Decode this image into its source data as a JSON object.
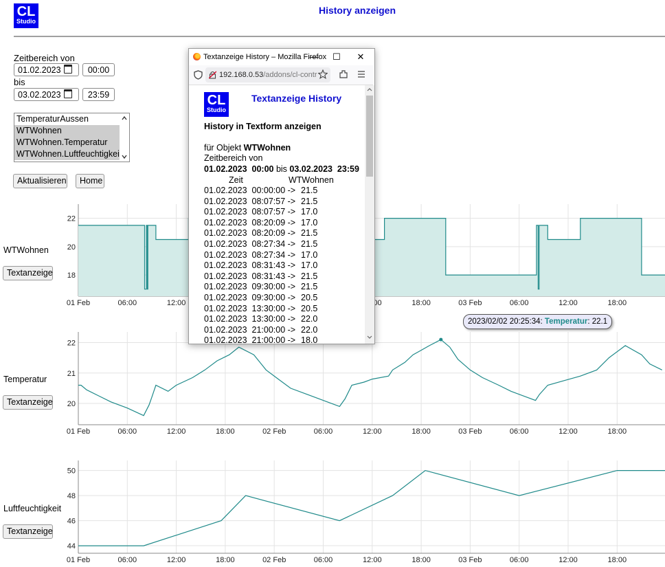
{
  "header": {
    "logo_line1": "CL",
    "logo_line2": "Studio",
    "title": "History anzeigen"
  },
  "form": {
    "from_label": "Zeitbereich von",
    "from_date": "01.02.2023",
    "from_time": "00:00",
    "to_label": "bis",
    "to_date": "03.02.2023",
    "to_time": "23:59",
    "objects": [
      {
        "label": "TemperaturAussen",
        "selected": false
      },
      {
        "label": "WTWohnen",
        "selected": true
      },
      {
        "label": "WTWohnen.Temperatur",
        "selected": true
      },
      {
        "label": "WTWohnen.Luftfeuchtigkeit",
        "selected": true
      }
    ],
    "refresh_button": "Aktualisieren",
    "home_button": "Home"
  },
  "charts": {
    "text_button": "Textanzeige",
    "x_ticks": [
      "01 Feb",
      "06:00",
      "12:00",
      "18:00",
      "02 Feb",
      "06:00",
      "12:00",
      "18:00",
      "03 Feb",
      "06:00",
      "12:00",
      "18:00"
    ]
  },
  "tooltip": {
    "time": "2023/02/02 20:25:34:",
    "series": "Temperatur",
    "value": ": 22.1"
  },
  "popup": {
    "window_title": "Textanzeige History – Mozilla Firefox",
    "url_host": "192.168.0.53",
    "url_path": "/addons/cl-contr",
    "logo_line1": "CL",
    "logo_line2": "Studio",
    "title": "Textanzeige History",
    "subtitle": "History in Textform anzeigen",
    "object_prefix": "für Objekt ",
    "object_name": "WTWohnen",
    "range_label": "Zeitbereich von",
    "range_from": "01.02.2023  00:00",
    "range_mid": " bis ",
    "range_to": "03.02.2023  23:59",
    "col_time": "Zeit",
    "col_value": "WTWohnen",
    "rows": [
      {
        "time": "01.02.2023  00:00:00 ->",
        "value": "21.5"
      },
      {
        "time": "01.02.2023  08:07:57 ->",
        "value": "21.5"
      },
      {
        "time": "01.02.2023  08:07:57 ->",
        "value": "17.0"
      },
      {
        "time": "01.02.2023  08:20:09 ->",
        "value": "17.0"
      },
      {
        "time": "01.02.2023  08:20:09 ->",
        "value": "21.5"
      },
      {
        "time": "01.02.2023  08:27:34 ->",
        "value": "21.5"
      },
      {
        "time": "01.02.2023  08:27:34 ->",
        "value": "17.0"
      },
      {
        "time": "01.02.2023  08:31:43 ->",
        "value": "17.0"
      },
      {
        "time": "01.02.2023  08:31:43 ->",
        "value": "21.5"
      },
      {
        "time": "01.02.2023  09:30:00 ->",
        "value": "21.5"
      },
      {
        "time": "01.02.2023  09:30:00 ->",
        "value": "20.5"
      },
      {
        "time": "01.02.2023  13:30:00 ->",
        "value": "20.5"
      },
      {
        "time": "01.02.2023  13:30:00 ->",
        "value": "22.0"
      },
      {
        "time": "01.02.2023  21:00:00 ->",
        "value": "22.0"
      },
      {
        "time": "01.02.2023  21:00:00 ->",
        "value": "18.0"
      }
    ]
  },
  "chart_data": [
    {
      "type": "area",
      "series": [
        {
          "name": "WTWohnen",
          "points": [
            [
              "01 Feb 00:00",
              21.5
            ],
            [
              "01 Feb 08:07",
              21.5
            ],
            [
              "01 Feb 08:07",
              17.0
            ],
            [
              "01 Feb 08:20",
              17.0
            ],
            [
              "01 Feb 08:20",
              21.5
            ],
            [
              "01 Feb 08:27",
              21.5
            ],
            [
              "01 Feb 08:27",
              17.0
            ],
            [
              "01 Feb 08:31",
              17.0
            ],
            [
              "01 Feb 08:31",
              21.5
            ],
            [
              "01 Feb 09:30",
              21.5
            ],
            [
              "01 Feb 09:30",
              20.5
            ],
            [
              "01 Feb 13:30",
              20.5
            ],
            [
              "01 Feb 13:30",
              22.0
            ],
            [
              "01 Feb 21:00",
              22.0
            ],
            [
              "01 Feb 21:00",
              18.0
            ],
            [
              "02 Feb 12:00",
              18.0
            ],
            [
              "02 Feb 12:00",
              20.5
            ],
            [
              "02 Feb 13:30",
              20.5
            ],
            [
              "02 Feb 13:30",
              22.0
            ],
            [
              "02 Feb 21:00",
              22.0
            ],
            [
              "02 Feb 21:00",
              18.0
            ],
            [
              "03 Feb 08:07",
              18.0
            ],
            [
              "03 Feb 08:07",
              21.5
            ],
            [
              "03 Feb 08:20",
              21.5
            ],
            [
              "03 Feb 08:20",
              17.0
            ],
            [
              "03 Feb 08:27",
              17.0
            ],
            [
              "03 Feb 08:27",
              21.5
            ],
            [
              "03 Feb 09:30",
              21.5
            ],
            [
              "03 Feb 09:30",
              20.5
            ],
            [
              "03 Feb 13:30",
              20.5
            ],
            [
              "03 Feb 13:30",
              22.0
            ],
            [
              "03 Feb 21:00",
              22.0
            ],
            [
              "03 Feb 21:00",
              18.0
            ],
            [
              "03 Feb 23:59",
              18.0
            ]
          ]
        }
      ],
      "y_ticks": [
        18,
        20,
        22
      ],
      "ylim": [
        16.5,
        23
      ],
      "xlim": [
        "01 Feb 00:00",
        "03 Feb 23:59"
      ],
      "label": "WTWohnen"
    },
    {
      "type": "line",
      "series": [
        {
          "name": "Temperatur",
          "points": [
            [
              "01 Feb 00:00",
              20.6
            ],
            [
              "01 Feb 00:20",
              20.6
            ],
            [
              "01 Feb 01:00",
              20.45
            ],
            [
              "01 Feb 02:30",
              20.25
            ],
            [
              "01 Feb 04:00",
              20.05
            ],
            [
              "01 Feb 06:00",
              19.85
            ],
            [
              "01 Feb 08:00",
              19.6
            ],
            [
              "01 Feb 08:40",
              19.95
            ],
            [
              "01 Feb 09:00",
              20.2
            ],
            [
              "01 Feb 09:30",
              20.6
            ],
            [
              "01 Feb 11:00",
              20.4
            ],
            [
              "01 Feb 12:00",
              20.6
            ],
            [
              "01 Feb 14:00",
              20.85
            ],
            [
              "01 Feb 15:30",
              21.1
            ],
            [
              "01 Feb 17:00",
              21.4
            ],
            [
              "01 Feb 18:30",
              21.6
            ],
            [
              "01 Feb 19:40",
              21.85
            ],
            [
              "01 Feb 21:30",
              21.6
            ],
            [
              "01 Feb 23:00",
              21.1
            ],
            [
              "02 Feb 00:30",
              20.8
            ],
            [
              "02 Feb 02:00",
              20.5
            ],
            [
              "02 Feb 04:00",
              20.3
            ],
            [
              "02 Feb 06:00",
              20.1
            ],
            [
              "02 Feb 08:00",
              19.9
            ],
            [
              "02 Feb 08:40",
              20.15
            ],
            [
              "02 Feb 09:30",
              20.6
            ],
            [
              "02 Feb 11:00",
              20.7
            ],
            [
              "02 Feb 12:00",
              20.8
            ],
            [
              "02 Feb 14:00",
              20.9
            ],
            [
              "02 Feb 14:30",
              21.1
            ],
            [
              "02 Feb 16:00",
              21.35
            ],
            [
              "02 Feb 17:00",
              21.6
            ],
            [
              "02 Feb 18:00",
              21.75
            ],
            [
              "02 Feb 19:00",
              21.9
            ],
            [
              "02 Feb 20:25",
              22.1
            ],
            [
              "02 Feb 21:30",
              21.85
            ],
            [
              "02 Feb 22:30",
              21.45
            ],
            [
              "03 Feb 00:00",
              21.1
            ],
            [
              "03 Feb 01:30",
              20.85
            ],
            [
              "03 Feb 03:30",
              20.6
            ],
            [
              "03 Feb 05:00",
              20.4
            ],
            [
              "03 Feb 08:00",
              20.1
            ],
            [
              "03 Feb 08:30",
              20.3
            ],
            [
              "03 Feb 09:30",
              20.6
            ],
            [
              "03 Feb 11:30",
              20.75
            ],
            [
              "03 Feb 13:30",
              20.9
            ],
            [
              "03 Feb 15:30",
              21.1
            ],
            [
              "03 Feb 17:00",
              21.5
            ],
            [
              "03 Feb 19:00",
              21.9
            ],
            [
              "03 Feb 21:00",
              21.6
            ],
            [
              "03 Feb 22:00",
              21.3
            ],
            [
              "03 Feb 23:30",
              21.1
            ]
          ]
        }
      ],
      "y_ticks": [
        20,
        21,
        22
      ],
      "ylim": [
        19.3,
        22.35
      ],
      "xlim": [
        "01 Feb 00:00",
        "03 Feb 23:59"
      ],
      "highlight": [
        "02 Feb 20:25",
        22.1
      ],
      "label": "Temperatur"
    },
    {
      "type": "line",
      "series": [
        {
          "name": "Luftfeuchtigkeit",
          "points": [
            [
              "01 Feb 00:00",
              44
            ],
            [
              "01 Feb 08:00",
              44
            ],
            [
              "01 Feb 17:30",
              46
            ],
            [
              "01 Feb 20:30",
              48
            ],
            [
              "02 Feb 08:00",
              46
            ],
            [
              "02 Feb 14:30",
              48
            ],
            [
              "02 Feb 18:30",
              50
            ],
            [
              "03 Feb 06:00",
              48
            ],
            [
              "03 Feb 18:00",
              50
            ],
            [
              "03 Feb 23:59",
              50
            ]
          ]
        }
      ],
      "y_ticks": [
        44,
        46,
        48,
        50
      ],
      "ylim": [
        43.4,
        50.8
      ],
      "xlim": [
        "01 Feb 00:00",
        "03 Feb 23:59"
      ],
      "label": "Luftfeuchtigkeit"
    }
  ]
}
